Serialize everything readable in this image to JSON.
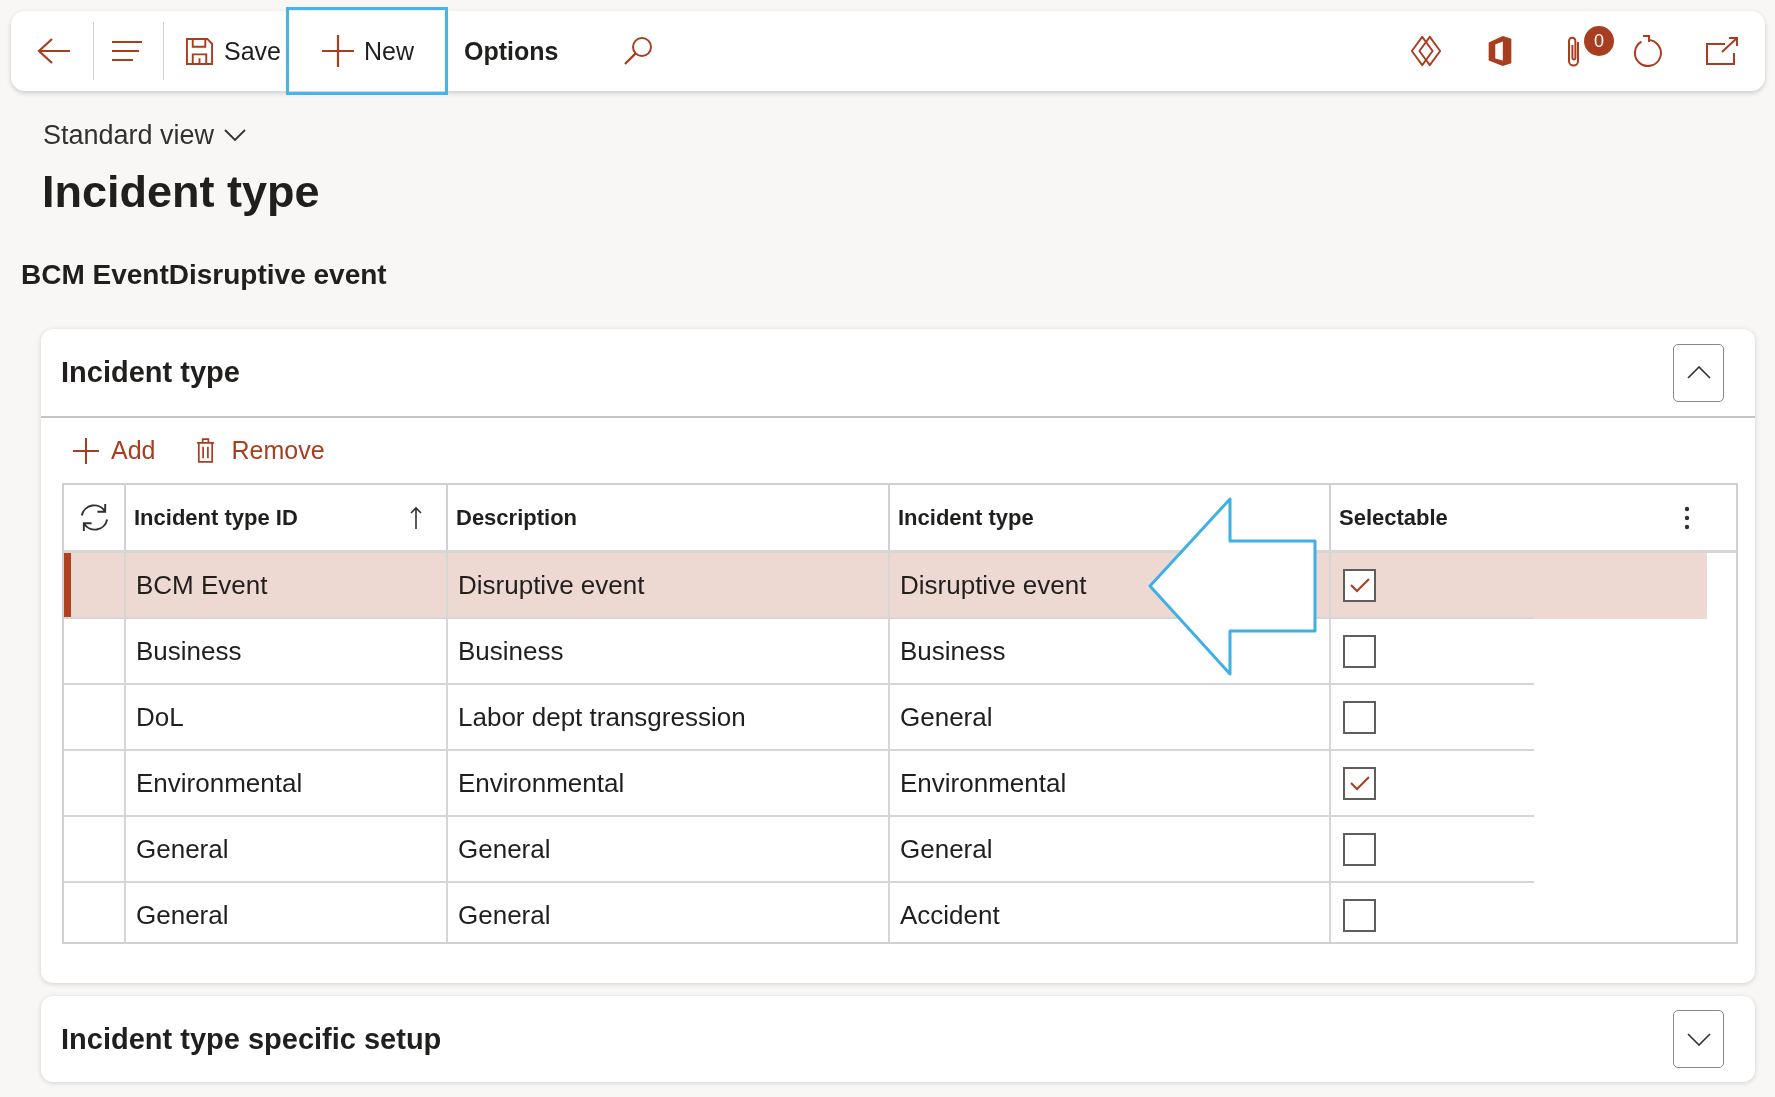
{
  "toolbar": {
    "actions": [
      {
        "kind": "save",
        "label": "Save",
        "focused": false
      },
      {
        "kind": "new",
        "label": "New",
        "focused": true
      },
      {
        "kind": "menu",
        "label": "Options",
        "focused": false
      }
    ],
    "attachments_count": "0"
  },
  "view_selector": "Standard view",
  "page_title": "Incident type",
  "record_caption": "BCM EventDisruptive event",
  "sections": [
    {
      "title": "Incident type",
      "expanded": true,
      "grid": {
        "actions": [
          {
            "kind": "add",
            "label": "Add"
          },
          {
            "kind": "remove",
            "label": "Remove"
          }
        ],
        "columns": [
          {
            "label": "Incident type ID",
            "sorted": true
          },
          {
            "label": "Description",
            "sorted": false
          },
          {
            "label": "Incident type",
            "sorted": false
          },
          {
            "label": "Selectable",
            "sorted": false
          }
        ],
        "rows": [
          {
            "incident_type_id": "BCM Event",
            "description": "Disruptive event",
            "incident_type": "Disruptive event",
            "selectable": true,
            "selected": true
          },
          {
            "incident_type_id": "Business",
            "description": "Business",
            "incident_type": "Business",
            "selectable": false,
            "selected": false
          },
          {
            "incident_type_id": "DoL",
            "description": "Labor dept transgression",
            "incident_type": "General",
            "selectable": false,
            "selected": false
          },
          {
            "incident_type_id": "Environmental",
            "description": "Environmental",
            "incident_type": "Environmental",
            "selectable": true,
            "selected": false
          },
          {
            "incident_type_id": "General",
            "description": "General",
            "incident_type": "General",
            "selectable": false,
            "selected": false
          },
          {
            "incident_type_id": "General",
            "description": "General",
            "incident_type": "Accident",
            "selectable": false,
            "selected": false
          }
        ]
      }
    },
    {
      "title": "Incident type specific setup",
      "expanded": false
    }
  ]
}
